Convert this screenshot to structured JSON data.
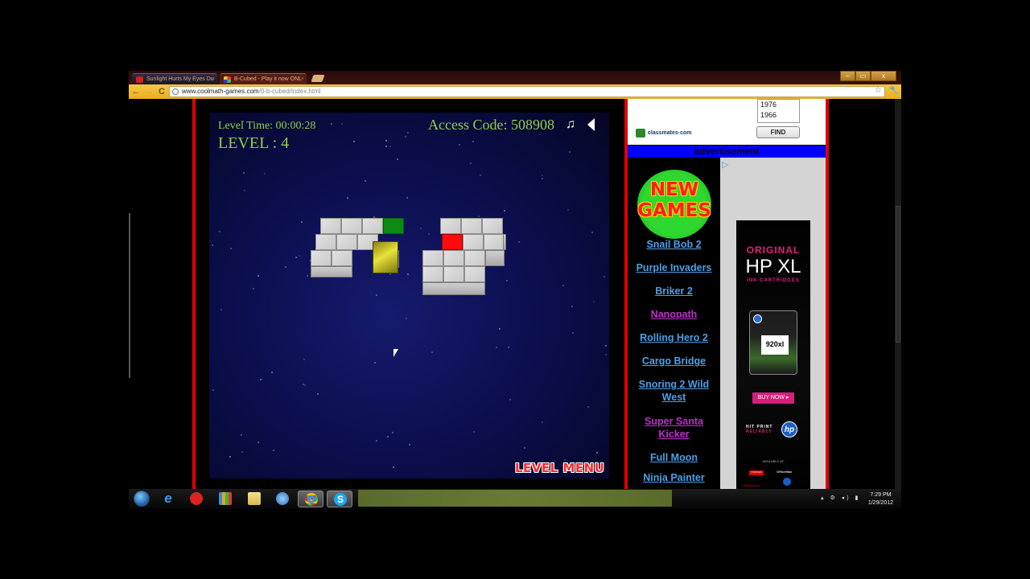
{
  "browser": {
    "tabs": [
      {
        "label": "Sunlight Hurts My Eyes Du",
        "favicon": "youtube-icon",
        "active": false
      },
      {
        "label": "B-Cubed - Play it now ONL",
        "favicon": "coolmath-icon",
        "active": true
      }
    ],
    "window_controls": {
      "minimize": "–",
      "maximize": "▭",
      "close": "x"
    },
    "nav": {
      "back": "←",
      "forward": "→",
      "reload": "C"
    },
    "url": {
      "host": "www.coolmath-games.com",
      "path": "/0-b-cubed/index.html"
    },
    "bookmark_icon": "☆",
    "menu_icon": "🔧"
  },
  "game": {
    "level_time_label": "Level Time: 00:00:28",
    "level_label": "LEVEL :  4",
    "access_code_label": "Access Code: 508908",
    "music_icon": "♫",
    "level_menu_label": "LEVEL MENU",
    "colors": {
      "hud_text": "#8ed04a",
      "start_tile": "#0b8a14",
      "goal_tile": "#ff0a0a",
      "player_cube": "#e8e23a"
    }
  },
  "sidebar": {
    "classmates": {
      "years": [
        "1976",
        "1966"
      ],
      "find_label": "FIND",
      "logo_text": "classmates·com"
    },
    "ad_banner": "advertisement",
    "new_games_title": [
      "NEW",
      "GAMES"
    ],
    "games": [
      {
        "label": "Snail Bob 2",
        "visited": false
      },
      {
        "label": "Purple Invaders",
        "visited": false
      },
      {
        "label": "Briker 2",
        "visited": false
      },
      {
        "label": "Nanopath",
        "visited": true
      },
      {
        "label": "Rolling Hero 2",
        "visited": false
      },
      {
        "label": "Cargo Bridge",
        "visited": false
      },
      {
        "label": "Snoring 2 Wild West",
        "visited": false
      },
      {
        "label": "Super Santa Kicker",
        "visited": true
      },
      {
        "label": "Full Moon",
        "visited": false
      },
      {
        "label": "Ninja Painter",
        "visited": false
      }
    ],
    "hp_ad": {
      "line1": "ORIGINAL",
      "line2": "HP XL",
      "line3": "INK CARTRIDGES",
      "cartridge_label": "920xl",
      "buy_now": "BUY NOW ▸",
      "tagline1": "HIT PRINT",
      "tagline2": "RELIABLY",
      "hp_logo": "hp",
      "available_at": "AVAILABLE AT:",
      "retailers": [
        "STAPLES",
        "OfficeMax",
        "OfficeDepot"
      ]
    },
    "adchoices_icon": "▷"
  },
  "taskbar": {
    "apps": [
      {
        "name": "start-orb"
      },
      {
        "name": "internet-explorer",
        "glyph": "e"
      },
      {
        "name": "app-red"
      },
      {
        "name": "media-app"
      },
      {
        "name": "file-explorer"
      },
      {
        "name": "app-blue"
      },
      {
        "name": "chrome",
        "active": true
      },
      {
        "name": "skype",
        "glyph": "S",
        "active": true
      }
    ],
    "tray_icons": "▴ ⚙ ◂) ▮",
    "clock_time": "7:29 PM",
    "clock_date": "1/29/2012"
  }
}
